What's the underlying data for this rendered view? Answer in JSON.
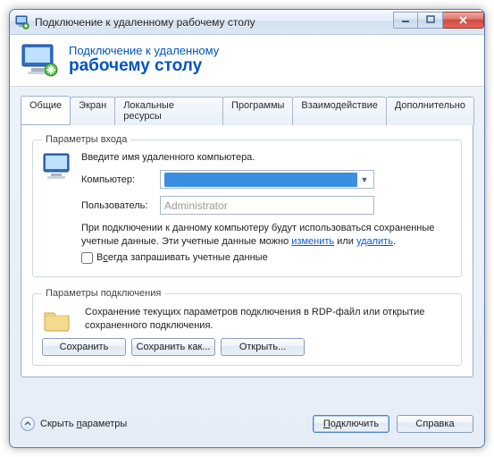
{
  "window": {
    "title": "Подключение к удаленному рабочему столу"
  },
  "banner": {
    "line1": "Подключение к удаленному",
    "line2": "рабочему столу"
  },
  "tabs": [
    {
      "label": "Общие"
    },
    {
      "label": "Экран"
    },
    {
      "label": "Локальные ресурсы"
    },
    {
      "label": "Программы"
    },
    {
      "label": "Взаимодействие"
    },
    {
      "label": "Дополнительно"
    }
  ],
  "login": {
    "group_title": "Параметры входа",
    "intro": "Введите имя удаленного компьютера.",
    "computer_label": "Компьютер:",
    "computer_value": "            ",
    "user_label": "Пользователь:",
    "user_placeholder": "Administrator",
    "note_before": "При подключении к данному компьютеру будут использоваться сохраненные учетные данные.  Эти учетные данные можно ",
    "link_edit": "изменить",
    "note_or": " или ",
    "link_delete": "удалить",
    "note_after": ".",
    "checkbox_label_pre": "В",
    "checkbox_label_ul": "с",
    "checkbox_label_post": "егда запрашивать учетные данные"
  },
  "conn": {
    "group_title": "Параметры подключения",
    "desc": "Сохранение текущих параметров подключения в RDP-файл или открытие сохраненного подключения.",
    "btn_save": "Сохранить",
    "btn_save_as": "Сохранить как...",
    "btn_open": "Открыть..."
  },
  "footer": {
    "toggle_label_pre": "Скрыть ",
    "toggle_label_ul": "п",
    "toggle_label_post": "араметры",
    "btn_connect_pre": "",
    "btn_connect_ul": "П",
    "btn_connect_post": "одключить",
    "btn_help": "Справка"
  }
}
